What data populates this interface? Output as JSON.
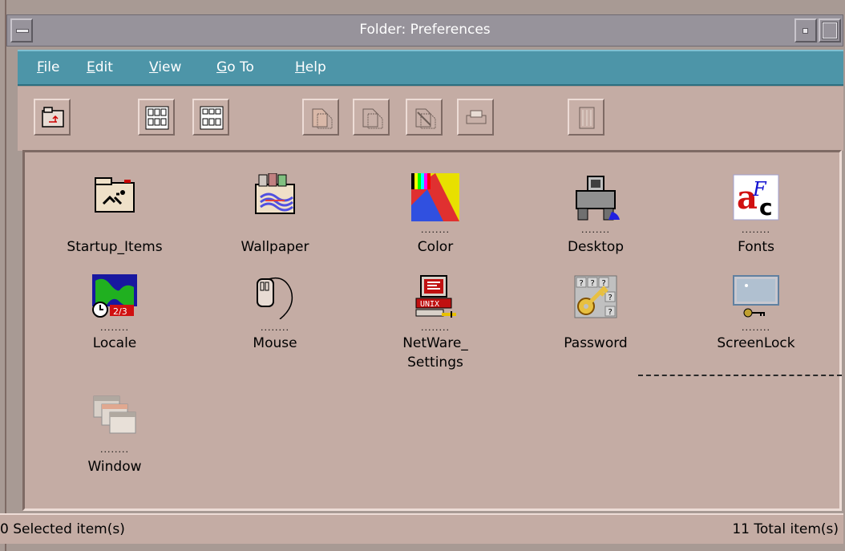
{
  "window": {
    "title": "Folder: Preferences"
  },
  "menu": {
    "items": [
      {
        "mnemonic": "F",
        "rest": "ile"
      },
      {
        "mnemonic": "E",
        "rest": "dit"
      },
      {
        "mnemonic": "V",
        "rest": "iew"
      },
      {
        "mnemonic": "G",
        "rest": "o To"
      },
      {
        "mnemonic": "H",
        "rest": "elp"
      }
    ]
  },
  "toolbar": {
    "buttons": [
      "folder-up-icon",
      "icon-view-icon",
      "list-view-icon",
      "copy-icon",
      "move-icon",
      "link-icon",
      "print-icon",
      "trash-icon"
    ]
  },
  "items": [
    {
      "label": "Startup_Items",
      "dots": "",
      "icon": "startup-items-icon"
    },
    {
      "label": "Wallpaper",
      "dots": "",
      "icon": "wallpaper-icon"
    },
    {
      "label": "Color",
      "dots": "........",
      "icon": "color-icon"
    },
    {
      "label": "Desktop",
      "dots": "........",
      "icon": "desktop-icon"
    },
    {
      "label": "Fonts",
      "dots": "........",
      "icon": "fonts-icon"
    },
    {
      "label": "Locale",
      "dots": "........",
      "icon": "locale-icon"
    },
    {
      "label": "Mouse",
      "dots": "........",
      "icon": "mouse-icon"
    },
    {
      "label": "NetWare_",
      "label2": "Settings",
      "dots": "........",
      "icon": "netware-icon"
    },
    {
      "label": "Password",
      "dots": "",
      "icon": "password-icon"
    },
    {
      "label": "ScreenLock",
      "dots": "........",
      "icon": "screenlock-icon"
    },
    {
      "label": "Window",
      "dots": "........",
      "icon": "window-icon"
    }
  ],
  "status": {
    "selected": "0 Selected item(s)",
    "total": "11 Total item(s)"
  },
  "colors": {
    "menubar": "#4d95a8",
    "background": "#c4aca4",
    "titlebar": "#97939b"
  }
}
